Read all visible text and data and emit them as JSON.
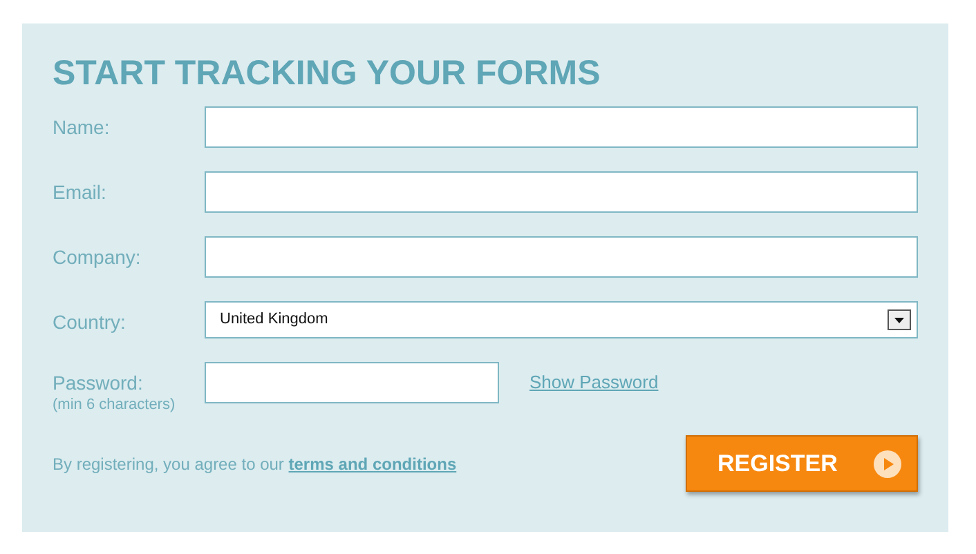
{
  "title": "START TRACKING YOUR FORMS",
  "fields": [
    {
      "label": "Name:",
      "kind": "text"
    },
    {
      "label": "Email:",
      "kind": "text"
    },
    {
      "label": "Company:",
      "kind": "text"
    },
    {
      "label": "Country:",
      "kind": "select",
      "value": "United Kingdom"
    },
    {
      "label": "Password:",
      "hint": "(min 6 characters)",
      "kind": "password",
      "link": "Show Password"
    }
  ],
  "agreement": {
    "text": "By registering, you agree to our",
    "link": "terms and conditions"
  },
  "submit": "REGISTER"
}
